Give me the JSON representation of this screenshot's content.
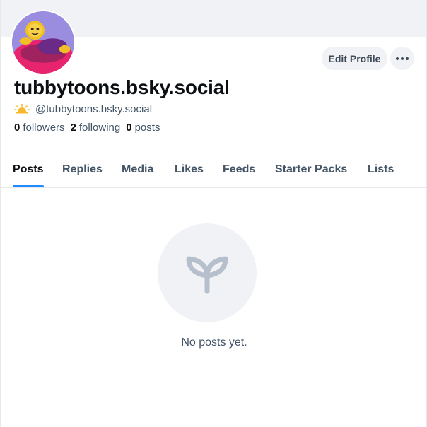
{
  "profile": {
    "display_name": "tubbytoons.bsky.social",
    "handle": "@tubbytoons.bsky.social",
    "avatar_icon": "avatar-image",
    "handle_icon": "sun-icon"
  },
  "actions": {
    "edit_profile_label": "Edit Profile",
    "more_icon": "ellipsis-icon"
  },
  "stats": {
    "followers_count": "0",
    "followers_label": "followers",
    "following_count": "2",
    "following_label": "following",
    "posts_count": "0",
    "posts_label": "posts"
  },
  "tabs": [
    {
      "label": "Posts",
      "active": true
    },
    {
      "label": "Replies",
      "active": false
    },
    {
      "label": "Media",
      "active": false
    },
    {
      "label": "Likes",
      "active": false
    },
    {
      "label": "Feeds",
      "active": false
    },
    {
      "label": "Starter Packs",
      "active": false
    },
    {
      "label": "Lists",
      "active": false
    }
  ],
  "empty_state": {
    "icon": "sprout-icon",
    "message": "No posts yet."
  },
  "colors": {
    "accent": "#208bfe",
    "text_primary": "#0b0f14",
    "text_secondary": "#425466",
    "surface": "#f0f2f5"
  }
}
